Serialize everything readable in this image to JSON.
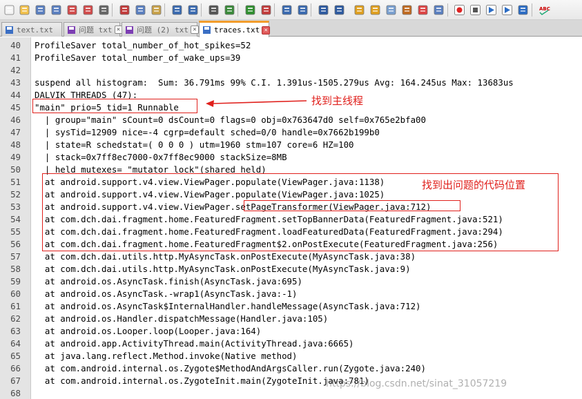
{
  "toolbar": {
    "buttons": [
      {
        "icon": "new-file-icon"
      },
      {
        "icon": "open-folder-icon"
      },
      {
        "icon": "save-icon"
      },
      {
        "icon": "save-all-icon"
      },
      {
        "icon": "close-icon"
      },
      {
        "icon": "close-all-icon"
      },
      {
        "icon": "print-icon"
      },
      {
        "icon": "cut-icon"
      },
      {
        "icon": "copy-icon"
      },
      {
        "icon": "paste-icon"
      },
      {
        "icon": "undo-icon"
      },
      {
        "icon": "redo-icon"
      },
      {
        "icon": "find-icon"
      },
      {
        "icon": "replace-icon"
      },
      {
        "icon": "zoom-in-icon"
      },
      {
        "icon": "zoom-out-icon"
      },
      {
        "icon": "sync-vertical-icon"
      },
      {
        "icon": "sync-horizontal-icon"
      },
      {
        "icon": "word-wrap-icon"
      },
      {
        "icon": "show-all-characters-icon"
      },
      {
        "icon": "indent-guide-icon"
      },
      {
        "icon": "user-language-icon"
      },
      {
        "icon": "document-map-icon"
      },
      {
        "icon": "function-list-icon"
      },
      {
        "icon": "folder-workspace-icon"
      },
      {
        "icon": "monitoring-icon"
      },
      {
        "icon": "record-macro-icon"
      },
      {
        "icon": "stop-recording-icon"
      },
      {
        "icon": "play-macro-icon"
      },
      {
        "icon": "run-macro-multiple-icon"
      },
      {
        "icon": "save-macro-icon"
      },
      {
        "icon": "spell-check-icon"
      }
    ],
    "spellcheck_label": "ABC"
  },
  "tabs": [
    {
      "label": "text.txt",
      "active": false
    },
    {
      "label": "问题 txt",
      "active": false
    },
    {
      "label": "问题 (2) txt",
      "active": false
    },
    {
      "label": "traces.txt",
      "active": true
    }
  ],
  "editor": {
    "lines": [
      {
        "num": "40",
        "text": "ProfileSaver total_number_of_hot_spikes=52"
      },
      {
        "num": "41",
        "text": "ProfileSaver total_number_of_wake_ups=39"
      },
      {
        "num": "42",
        "text": ""
      },
      {
        "num": "43",
        "text": "suspend all histogram:  Sum: 36.791ms 99% C.I. 1.391us-1505.279us Avg: 164.245us Max: 13683us"
      },
      {
        "num": "44",
        "text": "DALVIK THREADS (47):"
      },
      {
        "num": "45",
        "text": "\"main\" prio=5 tid=1 Runnable"
      },
      {
        "num": "46",
        "text": "  | group=\"main\" sCount=0 dsCount=0 flags=0 obj=0x763647d0 self=0x765e2bfa00"
      },
      {
        "num": "47",
        "text": "  | sysTid=12909 nice=-4 cgrp=default sched=0/0 handle=0x7662b199b0"
      },
      {
        "num": "48",
        "text": "  | state=R schedstat=( 0 0 0 ) utm=1960 stm=107 core=6 HZ=100"
      },
      {
        "num": "49",
        "text": "  | stack=0x7ff8ec7000-0x7ff8ec9000 stackSize=8MB"
      },
      {
        "num": "50",
        "text": "  | held mutexes= \"mutator lock\"(shared held)"
      },
      {
        "num": "51",
        "text": "  at android.support.v4.view.ViewPager.populate(ViewPager.java:1138)"
      },
      {
        "num": "52",
        "text": "  at android.support.v4.view.ViewPager.populate(ViewPager.java:1025)"
      },
      {
        "num": "53",
        "text": "  at android.support.v4.view.ViewPager.setPageTransformer(ViewPager.java:712)"
      },
      {
        "num": "54",
        "text": "  at com.dch.dai.fragment.home.FeaturedFragment.setTopBannerData(FeaturedFragment.java:521)"
      },
      {
        "num": "55",
        "text": "  at com.dch.dai.fragment.home.FeaturedFragment.loadFeaturedData(FeaturedFragment.java:294)"
      },
      {
        "num": "56",
        "text": "  at com.dch.dai.fragment.home.FeaturedFragment$2.onPostExecute(FeaturedFragment.java:256)"
      },
      {
        "num": "57",
        "text": "  at com.dch.dai.utils.http.MyAsyncTask.onPostExecute(MyAsyncTask.java:38)"
      },
      {
        "num": "58",
        "text": "  at com.dch.dai.utils.http.MyAsyncTask.onPostExecute(MyAsyncTask.java:9)"
      },
      {
        "num": "59",
        "text": "  at android.os.AsyncTask.finish(AsyncTask.java:695)"
      },
      {
        "num": "60",
        "text": "  at android.os.AsyncTask.-wrap1(AsyncTask.java:-1)"
      },
      {
        "num": "61",
        "text": "  at android.os.AsyncTask$InternalHandler.handleMessage(AsyncTask.java:712)"
      },
      {
        "num": "62",
        "text": "  at android.os.Handler.dispatchMessage(Handler.java:105)"
      },
      {
        "num": "63",
        "text": "  at android.os.Looper.loop(Looper.java:164)"
      },
      {
        "num": "64",
        "text": "  at android.app.ActivityThread.main(ActivityThread.java:6665)"
      },
      {
        "num": "65",
        "text": "  at java.lang.reflect.Method.invoke(Native method)"
      },
      {
        "num": "66",
        "text": "  at com.android.internal.os.Zygote$MethodAndArgsCaller.run(Zygote.java:240)"
      },
      {
        "num": "67",
        "text": "  at com.android.internal.os.ZygoteInit.main(ZygoteInit.java:781)"
      },
      {
        "num": "68",
        "text": ""
      }
    ]
  },
  "annotations": {
    "main_thread_note": "找到主线程",
    "problem_code_note": "找到出问题的代码位置",
    "color": "#e0201c"
  },
  "watermark": "https://blog.csdn.net/sinat_31057219"
}
